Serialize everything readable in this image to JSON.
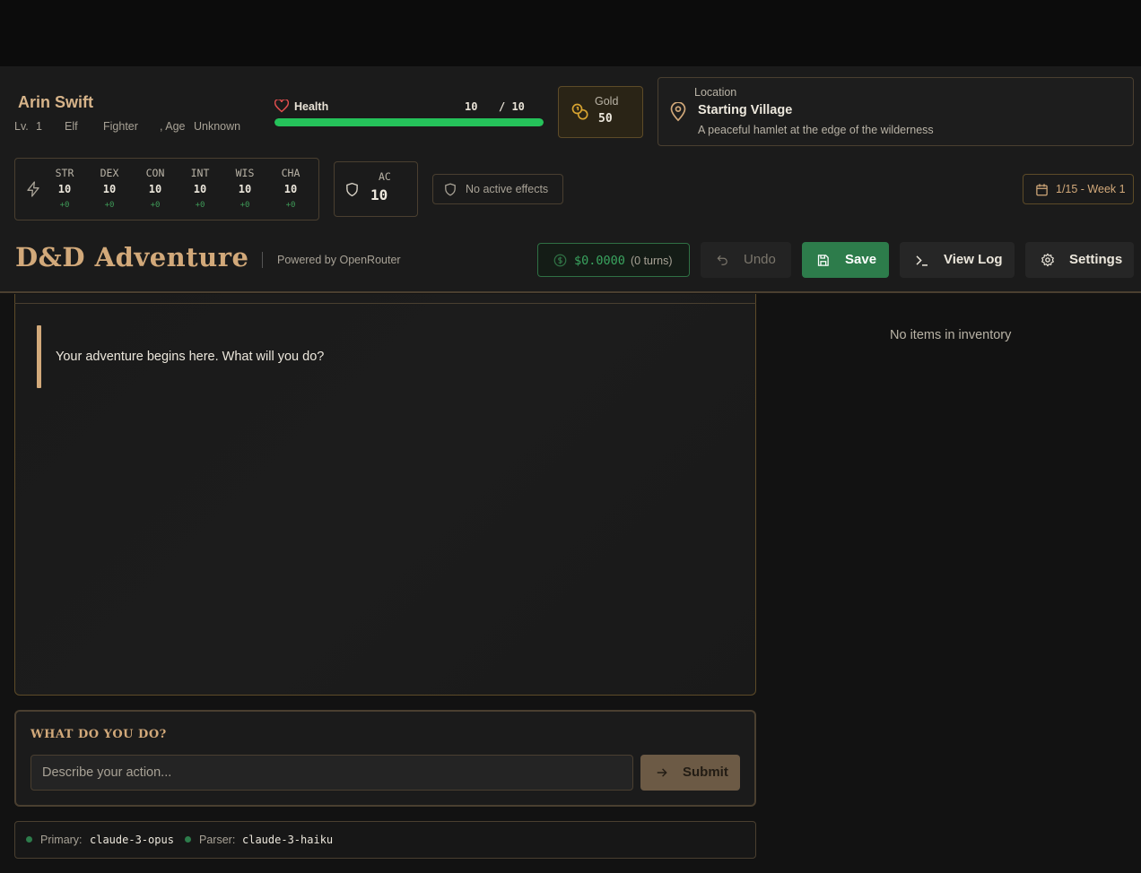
{
  "character": {
    "name": "Arin Swift",
    "level_label": "Lv.",
    "level": "1",
    "race": "Elf",
    "class": "Fighter",
    "age_label": ", Age",
    "age": "Unknown"
  },
  "health": {
    "label": "Health",
    "current": "10",
    "max": "/ 10",
    "fraction": 1.0
  },
  "gold": {
    "label": "Gold",
    "value": "50"
  },
  "location": {
    "label": "Location",
    "name": "Starting Village",
    "description": "A peaceful hamlet at the edge of the wilderness"
  },
  "stats": [
    {
      "name": "STR",
      "value": "10",
      "mod": "+0"
    },
    {
      "name": "DEX",
      "value": "10",
      "mod": "+0"
    },
    {
      "name": "CON",
      "value": "10",
      "mod": "+0"
    },
    {
      "name": "INT",
      "value": "10",
      "mod": "+0"
    },
    {
      "name": "WIS",
      "value": "10",
      "mod": "+0"
    },
    {
      "name": "CHA",
      "value": "10",
      "mod": "+0"
    }
  ],
  "armor": {
    "label": "AC",
    "value": "10"
  },
  "effects": {
    "label": "No active effects"
  },
  "date": {
    "label": "1/15 - Week 1"
  },
  "brand": {
    "title": "D&D Adventure",
    "subtitle": "Powered by OpenRouter"
  },
  "toolbar": {
    "cost": "$0.0000",
    "turns": "(0 turns)",
    "undo": "Undo",
    "save": "Save",
    "view_log": "View Log",
    "settings": "Settings"
  },
  "story": {
    "text": "Your adventure begins here. What will you do?"
  },
  "inventory": {
    "empty_text": "No items in inventory"
  },
  "action": {
    "title": "WHAT DO YOU DO?",
    "placeholder": "Describe your action...",
    "submit": "Submit"
  },
  "models": {
    "primary_label": "Primary:",
    "primary": "claude-3-opus",
    "parser_label": "Parser:",
    "parser": "claude-3-haiku"
  },
  "colors": {
    "accent_gold": "#d2a97a",
    "health_green": "#25c25a",
    "save_green": "#2d7c4b",
    "border_brown": "#4a3f30"
  }
}
